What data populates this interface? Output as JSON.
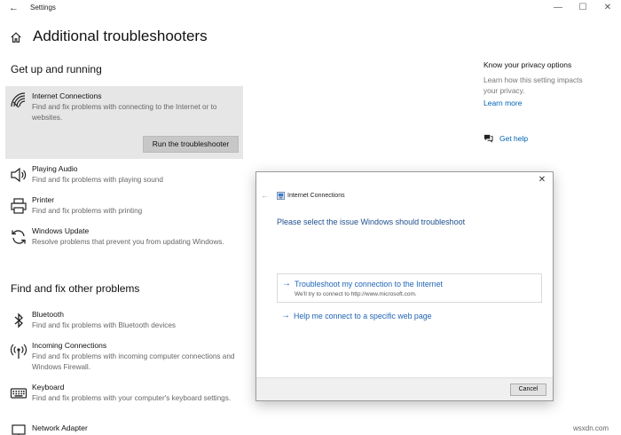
{
  "window": {
    "title": "Settings",
    "back_glyph": "←",
    "minimize_glyph": "—",
    "maximize_glyph": "☐",
    "close_glyph": "✕"
  },
  "header": {
    "title": "Additional troubleshooters"
  },
  "sections": {
    "get_up_running": "Get up and running",
    "find_fix_other": "Find and fix other problems"
  },
  "items": [
    {
      "icon": "wifi-icon",
      "name": "Internet Connections",
      "desc": "Find and fix problems with connecting to the Internet or to websites."
    },
    {
      "icon": "speaker-icon",
      "name": "Playing Audio",
      "desc": "Find and fix problems with playing sound"
    },
    {
      "icon": "printer-icon",
      "name": "Printer",
      "desc": "Find and fix problems with printing"
    },
    {
      "icon": "refresh-icon",
      "name": "Windows Update",
      "desc": "Resolve problems that prevent you from updating Windows."
    },
    {
      "icon": "bluetooth-icon",
      "name": "Bluetooth",
      "desc": "Find and fix problems with Bluetooth devices"
    },
    {
      "icon": "antenna-icon",
      "name": "Incoming Connections",
      "desc": "Find and fix problems with incoming computer connections and Windows Firewall."
    },
    {
      "icon": "keyboard-icon",
      "name": "Keyboard",
      "desc": "Find and fix problems with your computer's keyboard settings."
    },
    {
      "icon": "network-adapter-icon",
      "name": "Network Adapter",
      "desc": ""
    }
  ],
  "run_button": "Run the troubleshooter",
  "privacy": {
    "title": "Know your privacy options",
    "desc": "Learn how this setting impacts your privacy.",
    "learn_more": "Learn more",
    "get_help": "Get help"
  },
  "dialog": {
    "title": "Internet Connections",
    "heading": "Please select the issue Windows should troubleshoot",
    "options": [
      {
        "label": "Troubleshoot my connection to the Internet",
        "sub": "We'll try to connect to http://www.microsoft.com."
      },
      {
        "label": "Help me connect to a specific web page",
        "sub": ""
      }
    ],
    "arrow_glyph": "→",
    "back_glyph": "←",
    "close_glyph": "✕",
    "cancel": "Cancel"
  },
  "watermark": "wsxdn.com",
  "colors": {
    "link": "#0063b1",
    "dialog_link": "#1e64b4",
    "selected_bg": "#e6e6e6"
  }
}
